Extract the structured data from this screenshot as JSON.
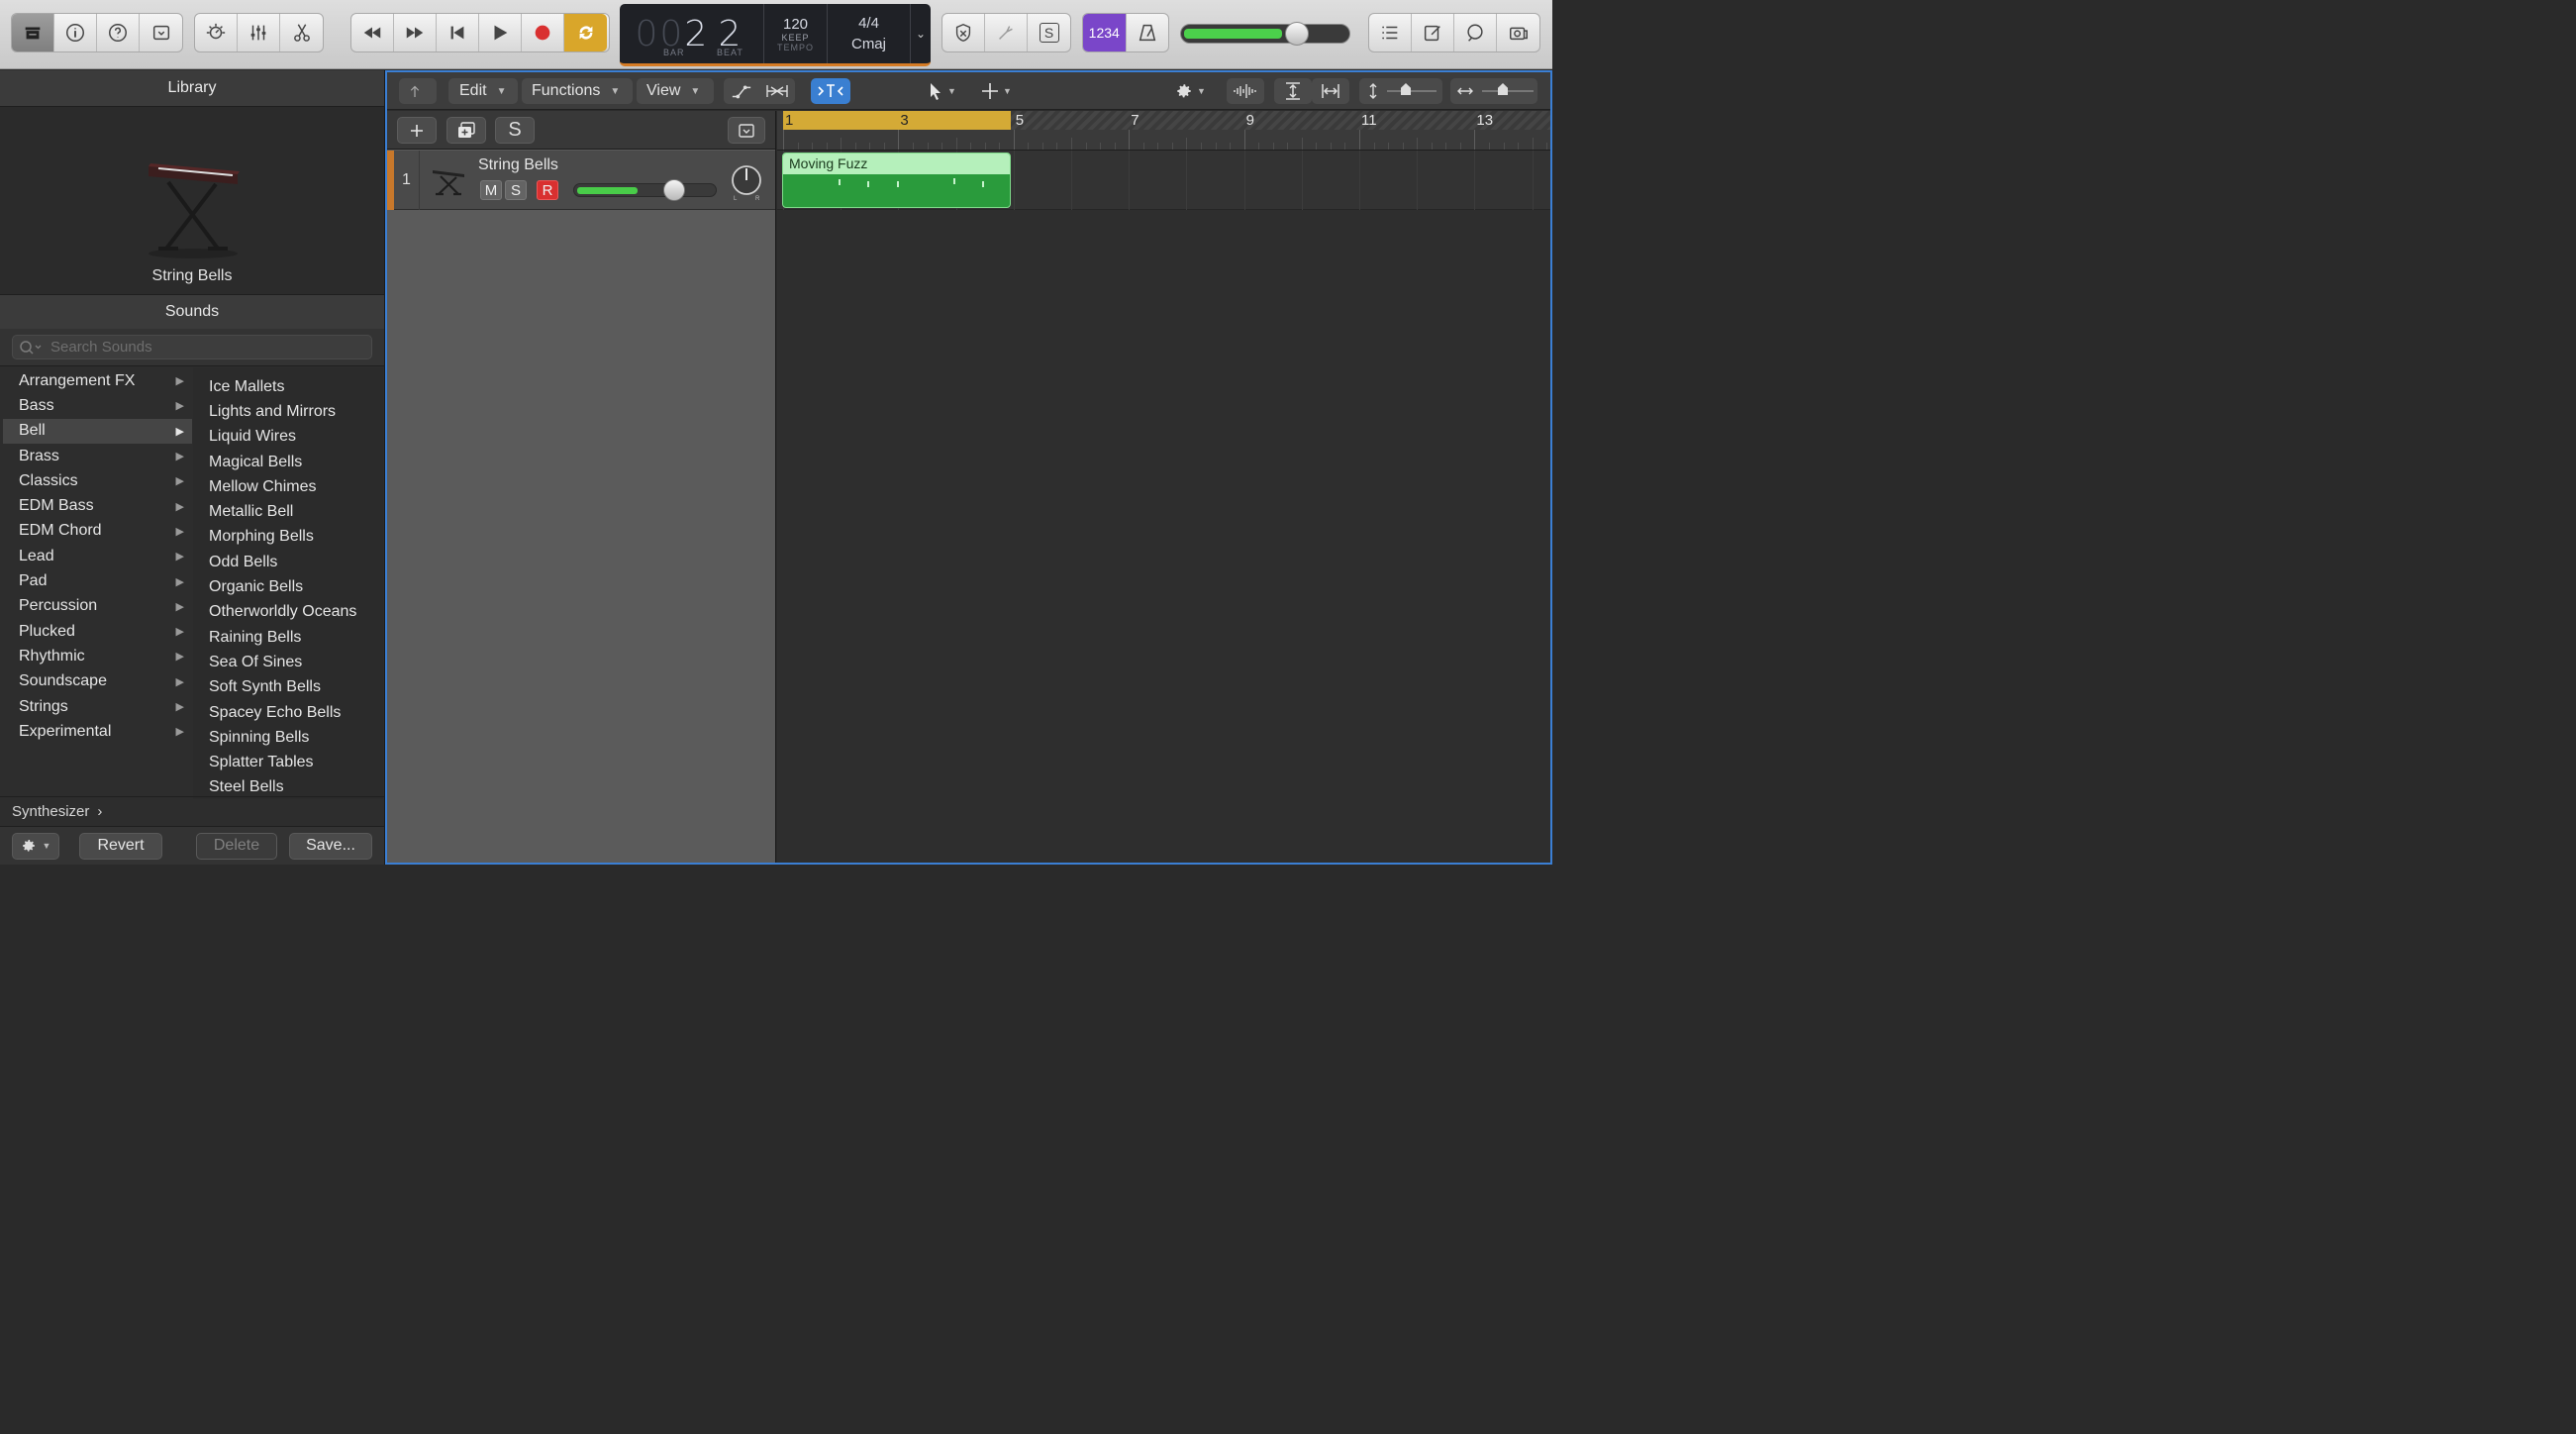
{
  "toolbar": {
    "lcd": {
      "bar_dim": "00",
      "bar": "2",
      "beat": "2",
      "bar_label": "BAR",
      "beat_label": "BEAT",
      "tempo": "120",
      "tempo_mode": "KEEP",
      "tempo_label": "TEMPO",
      "time_signature": "4/4",
      "key": "Cmaj"
    },
    "count_in_label": "1234",
    "solo_label": "S",
    "master_volume_level": 0.6
  },
  "library": {
    "title": "Library",
    "preset_name": "String Bells",
    "sounds_header": "Sounds",
    "search_placeholder": "Search Sounds",
    "categories": [
      {
        "label": "Arrangement FX"
      },
      {
        "label": "Bass"
      },
      {
        "label": "Bell"
      },
      {
        "label": "Brass"
      },
      {
        "label": "Classics"
      },
      {
        "label": "EDM Bass"
      },
      {
        "label": "EDM Chord"
      },
      {
        "label": "Lead"
      },
      {
        "label": "Pad"
      },
      {
        "label": "Percussion"
      },
      {
        "label": "Plucked"
      },
      {
        "label": "Rhythmic"
      },
      {
        "label": "Soundscape"
      },
      {
        "label": "Strings"
      },
      {
        "label": "Experimental"
      }
    ],
    "selected_category": "Bell",
    "patches": [
      {
        "label": "Ice Mallets"
      },
      {
        "label": "Lights and Mirrors"
      },
      {
        "label": "Liquid Wires"
      },
      {
        "label": "Magical Bells"
      },
      {
        "label": "Mellow Chimes"
      },
      {
        "label": "Metallic Bell"
      },
      {
        "label": "Morphing Bells"
      },
      {
        "label": "Odd Bells"
      },
      {
        "label": "Organic Bells"
      },
      {
        "label": "Otherworldly Oceans"
      },
      {
        "label": "Raining Bells"
      },
      {
        "label": "Sea Of Sines"
      },
      {
        "label": "Soft Synth Bells"
      },
      {
        "label": "Spacey Echo Bells"
      },
      {
        "label": "Spinning Bells"
      },
      {
        "label": "Splatter Tables"
      },
      {
        "label": "Steel Bells"
      }
    ],
    "path": "Synthesizer",
    "path_arrow": "›",
    "revert_label": "Revert",
    "delete_label": "Delete",
    "save_label": "Save..."
  },
  "tracks": {
    "menus": {
      "edit": "Edit",
      "functions": "Functions",
      "view": "View"
    },
    "header_solo": "S",
    "track": {
      "number": "1",
      "name": "String Bells",
      "mute": "M",
      "solo": "S",
      "record": "R",
      "volume_level": 0.55
    },
    "ruler_bars": [
      "1",
      "3",
      "5",
      "7",
      "9",
      "11",
      "13"
    ],
    "cycle_range": [
      "1",
      "5"
    ],
    "region": {
      "name": "Moving Fuzz"
    }
  },
  "colors": {
    "cycle": "#d4aa36",
    "region": "#2a9b3c",
    "record": "#d93030",
    "accent": "#3b7fd4",
    "track_color": "#c8782b"
  }
}
